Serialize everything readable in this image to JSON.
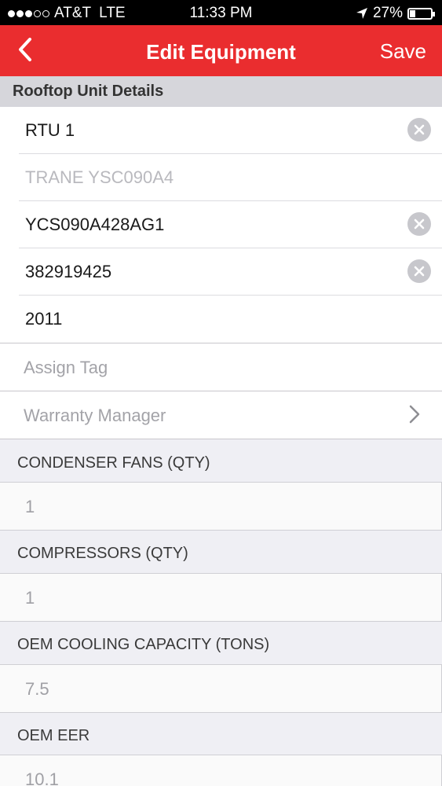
{
  "status_bar": {
    "carrier": "AT&T",
    "network": "LTE",
    "time": "11:33 PM",
    "battery": "27%",
    "battery_level": 0.27,
    "signal_bars_filled": 3,
    "signal_bars_total": 5
  },
  "nav": {
    "title": "Edit Equipment",
    "save_label": "Save",
    "back_icon": "chevron-left-icon"
  },
  "section": {
    "title": "Rooftop Unit Details"
  },
  "fields": {
    "name": "RTU 1",
    "model_placeholder": "TRANE YSC090A4",
    "model_number": "YCS090A428AG1",
    "serial_number": "382919425",
    "year": "2011"
  },
  "cells": {
    "assign_tag": "Assign Tag",
    "warranty_manager": "Warranty Manager"
  },
  "specs": [
    {
      "label": "CONDENSER FANS (QTY)",
      "value": "1"
    },
    {
      "label": "COMPRESSORS (QTY)",
      "value": "1"
    },
    {
      "label": "OEM COOLING CAPACITY (TONS)",
      "value": "7.5"
    },
    {
      "label": "OEM EER",
      "value": "10.1"
    }
  ],
  "colors": {
    "accent": "#ea2d2f",
    "section_bg": "#d6d6db",
    "background": "#efeff4"
  }
}
